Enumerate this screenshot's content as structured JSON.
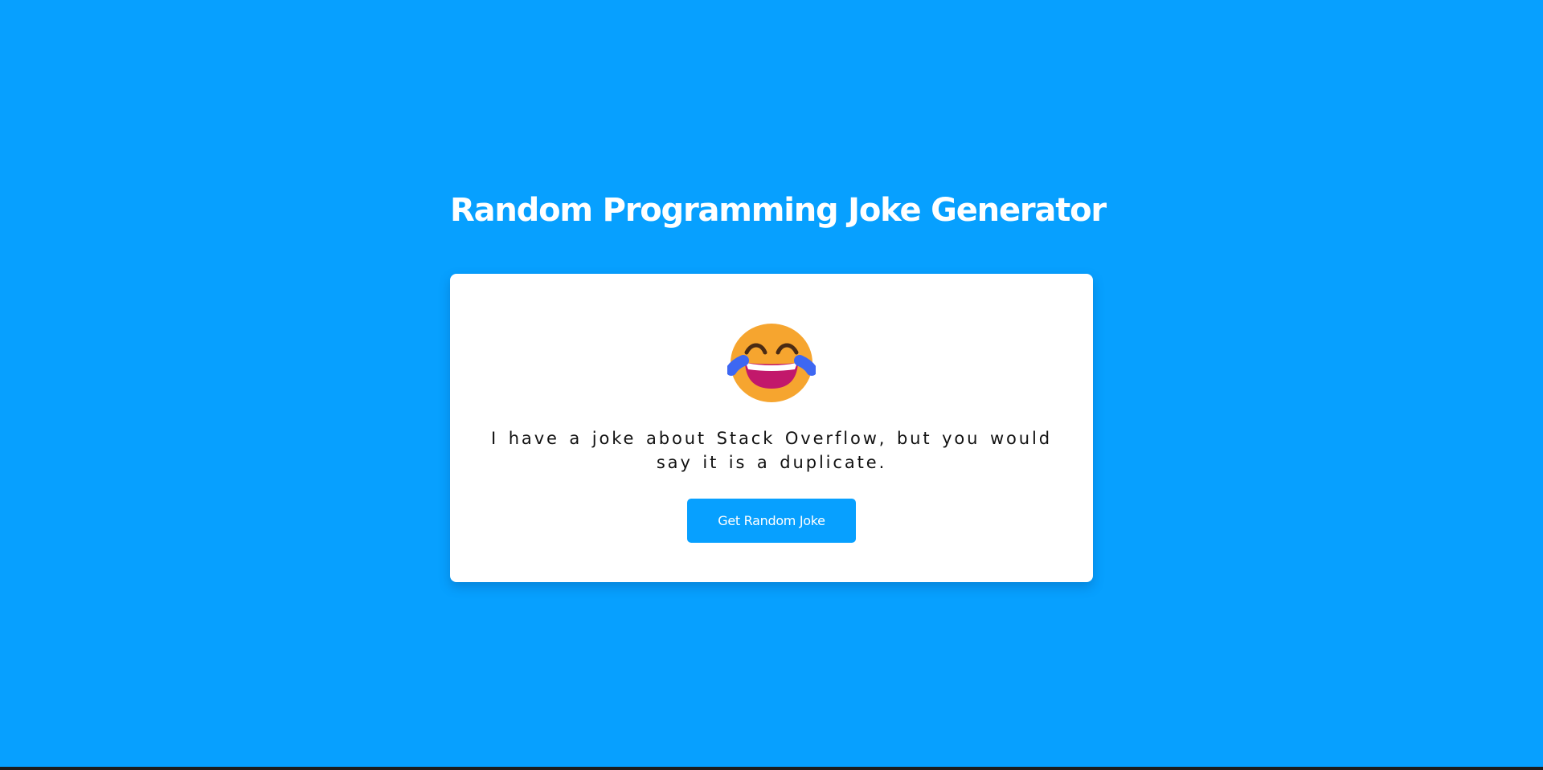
{
  "page": {
    "title": "Random Programming Joke Generator"
  },
  "card": {
    "emoji_icon": "laughing-face-with-tears-icon",
    "joke_text": "I have a joke about Stack Overflow, but you would say it is a duplicate.",
    "button_label": "Get Random Joke"
  },
  "colors": {
    "background": "#07a0ff",
    "card": "#ffffff",
    "button": "#07a0ff",
    "title_text": "#ffffff",
    "joke_text": "#111111"
  }
}
